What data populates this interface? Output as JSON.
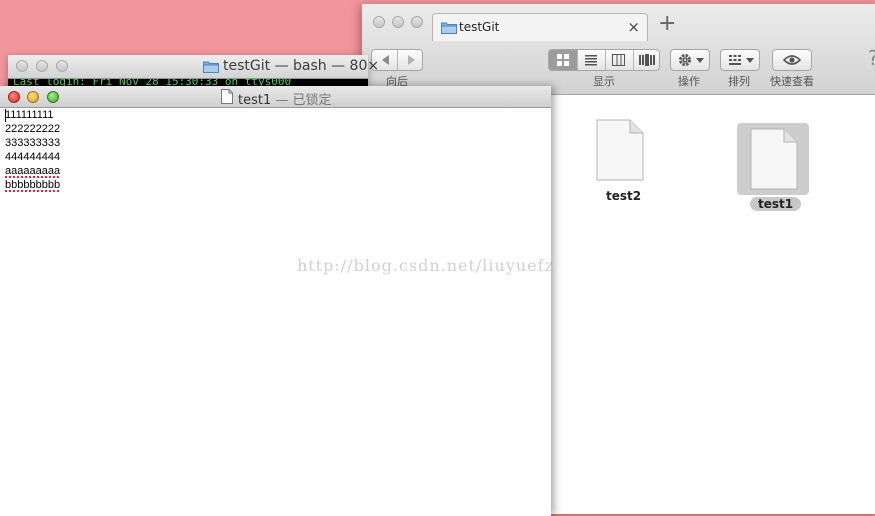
{
  "finder": {
    "tab_title": "testGit",
    "tab_close": "×",
    "tab_add": "+",
    "toolbar": {
      "back_label": "向后",
      "view_label": "显示",
      "action_label": "操作",
      "arrange_label": "排列",
      "quicklook_label": "快速查看",
      "help_glyph": "?"
    },
    "files": [
      {
        "name": "test2",
        "selected": false
      },
      {
        "name": "test1",
        "selected": true
      }
    ]
  },
  "terminal": {
    "title": "testGit — bash — 80×",
    "line": "Last login: Fri Nov 28 15:30:33 on ttys000"
  },
  "editor": {
    "title": "test1",
    "status": "— 已锁定",
    "lines": [
      "111111111",
      "222222222",
      "333333333",
      "444444444",
      "aaaaaaaaa",
      "bbbbbbbbb"
    ],
    "misspelled_lines": [
      4,
      5
    ]
  },
  "watermark": "http://blog.csdn.net/liuyuefz",
  "colors": {
    "desktop": "#f3969c",
    "terminal_text": "#5fd85f",
    "selection": "#c8c8c8"
  }
}
